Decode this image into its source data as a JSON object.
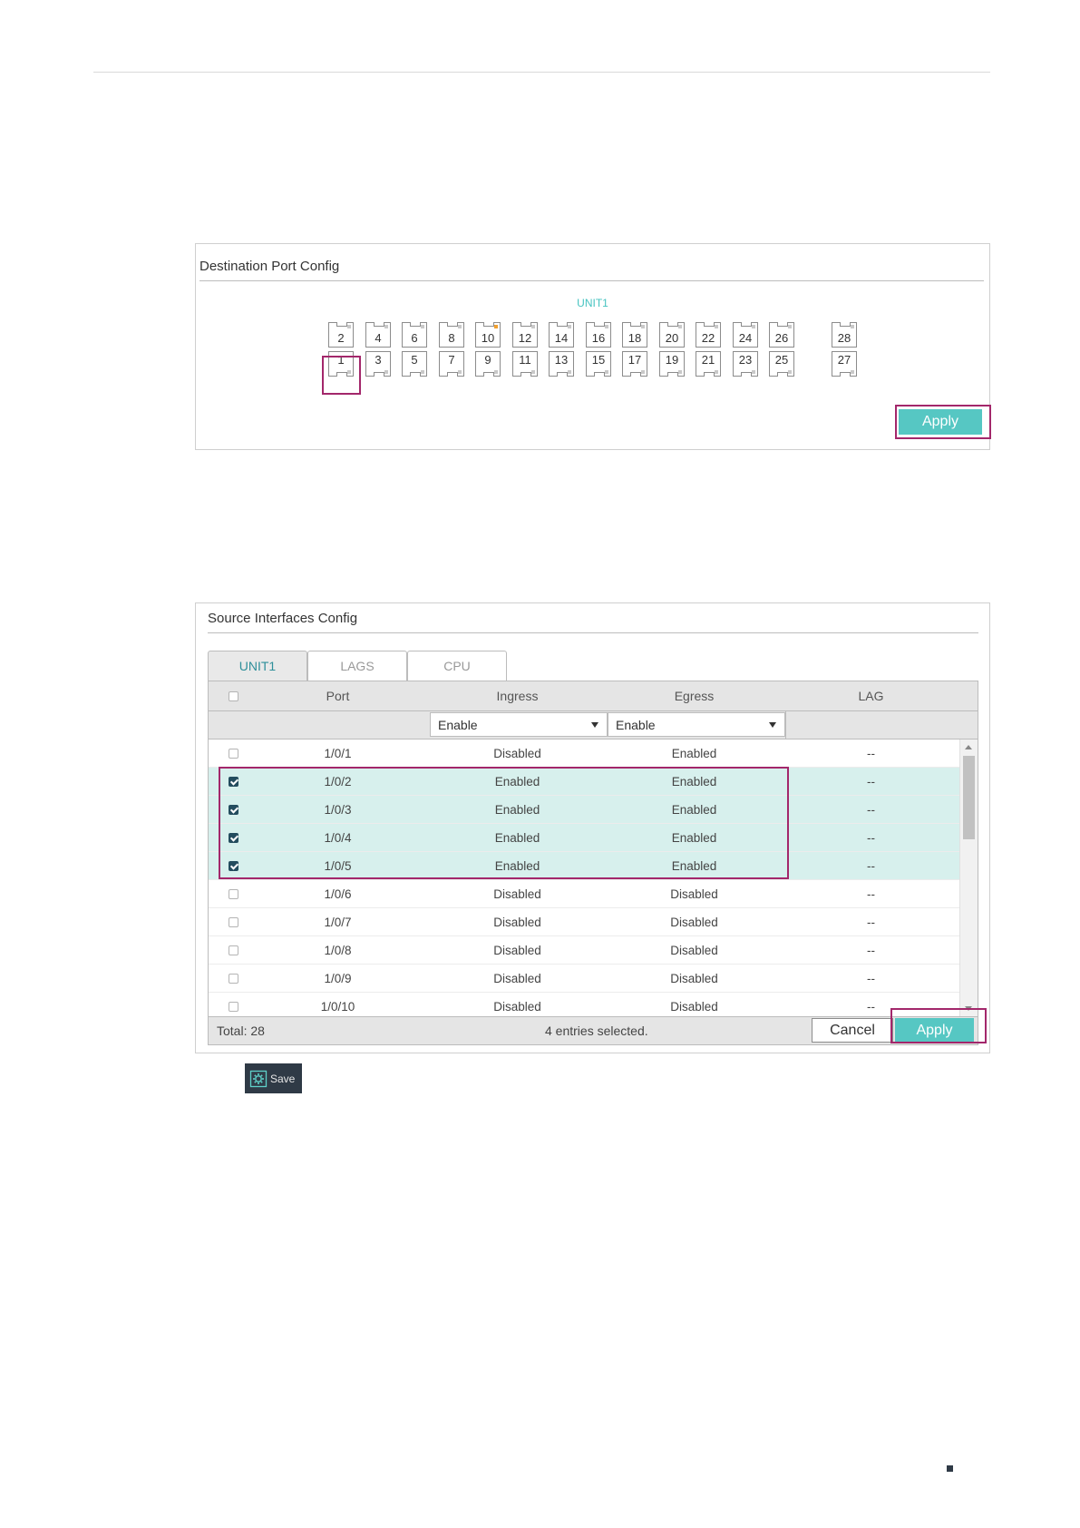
{
  "destination_panel": {
    "title": "Destination Port Config",
    "unit_label": "UNIT1",
    "top_ports": [
      "2",
      "4",
      "6",
      "8",
      "10",
      "12",
      "14",
      "16",
      "18",
      "20",
      "22",
      "24",
      "26",
      "28"
    ],
    "bottom_ports": [
      "1",
      "3",
      "5",
      "7",
      "9",
      "11",
      "13",
      "15",
      "17",
      "19",
      "21",
      "23",
      "25",
      "27"
    ],
    "active_port": "10",
    "selected_port": "1",
    "apply_label": "Apply"
  },
  "source_panel": {
    "title": "Source Interfaces Config",
    "tabs": [
      "UNIT1",
      "LAGS",
      "CPU"
    ],
    "active_tab": "UNIT1",
    "columns": {
      "port": "Port",
      "ingress": "Ingress",
      "egress": "Egress",
      "lag": "LAG"
    },
    "filter": {
      "ingress": "Enable",
      "egress": "Enable"
    },
    "rows": [
      {
        "port": "1/0/1",
        "ingress": "Disabled",
        "egress": "Enabled",
        "lag": "--",
        "checked": false
      },
      {
        "port": "1/0/2",
        "ingress": "Enabled",
        "egress": "Enabled",
        "lag": "--",
        "checked": true
      },
      {
        "port": "1/0/3",
        "ingress": "Enabled",
        "egress": "Enabled",
        "lag": "--",
        "checked": true
      },
      {
        "port": "1/0/4",
        "ingress": "Enabled",
        "egress": "Enabled",
        "lag": "--",
        "checked": true
      },
      {
        "port": "1/0/5",
        "ingress": "Enabled",
        "egress": "Enabled",
        "lag": "--",
        "checked": true
      },
      {
        "port": "1/0/6",
        "ingress": "Disabled",
        "egress": "Disabled",
        "lag": "--",
        "checked": false
      },
      {
        "port": "1/0/7",
        "ingress": "Disabled",
        "egress": "Disabled",
        "lag": "--",
        "checked": false
      },
      {
        "port": "1/0/8",
        "ingress": "Disabled",
        "egress": "Disabled",
        "lag": "--",
        "checked": false
      },
      {
        "port": "1/0/9",
        "ingress": "Disabled",
        "egress": "Disabled",
        "lag": "--",
        "checked": false
      },
      {
        "port": "1/0/10",
        "ingress": "Disabled",
        "egress": "Disabled",
        "lag": "--",
        "checked": false
      }
    ],
    "total": "Total: 28",
    "selected_info": "4 entries selected.",
    "cancel_label": "Cancel",
    "apply_label": "Apply"
  },
  "save_button": {
    "label": "Save",
    "icon": "gear-save-icon"
  },
  "colors": {
    "accent": "#56c7c3",
    "highlight": "#a3276b",
    "selected_row": "#d7f0ed",
    "unit_label": "#45c3c0"
  }
}
